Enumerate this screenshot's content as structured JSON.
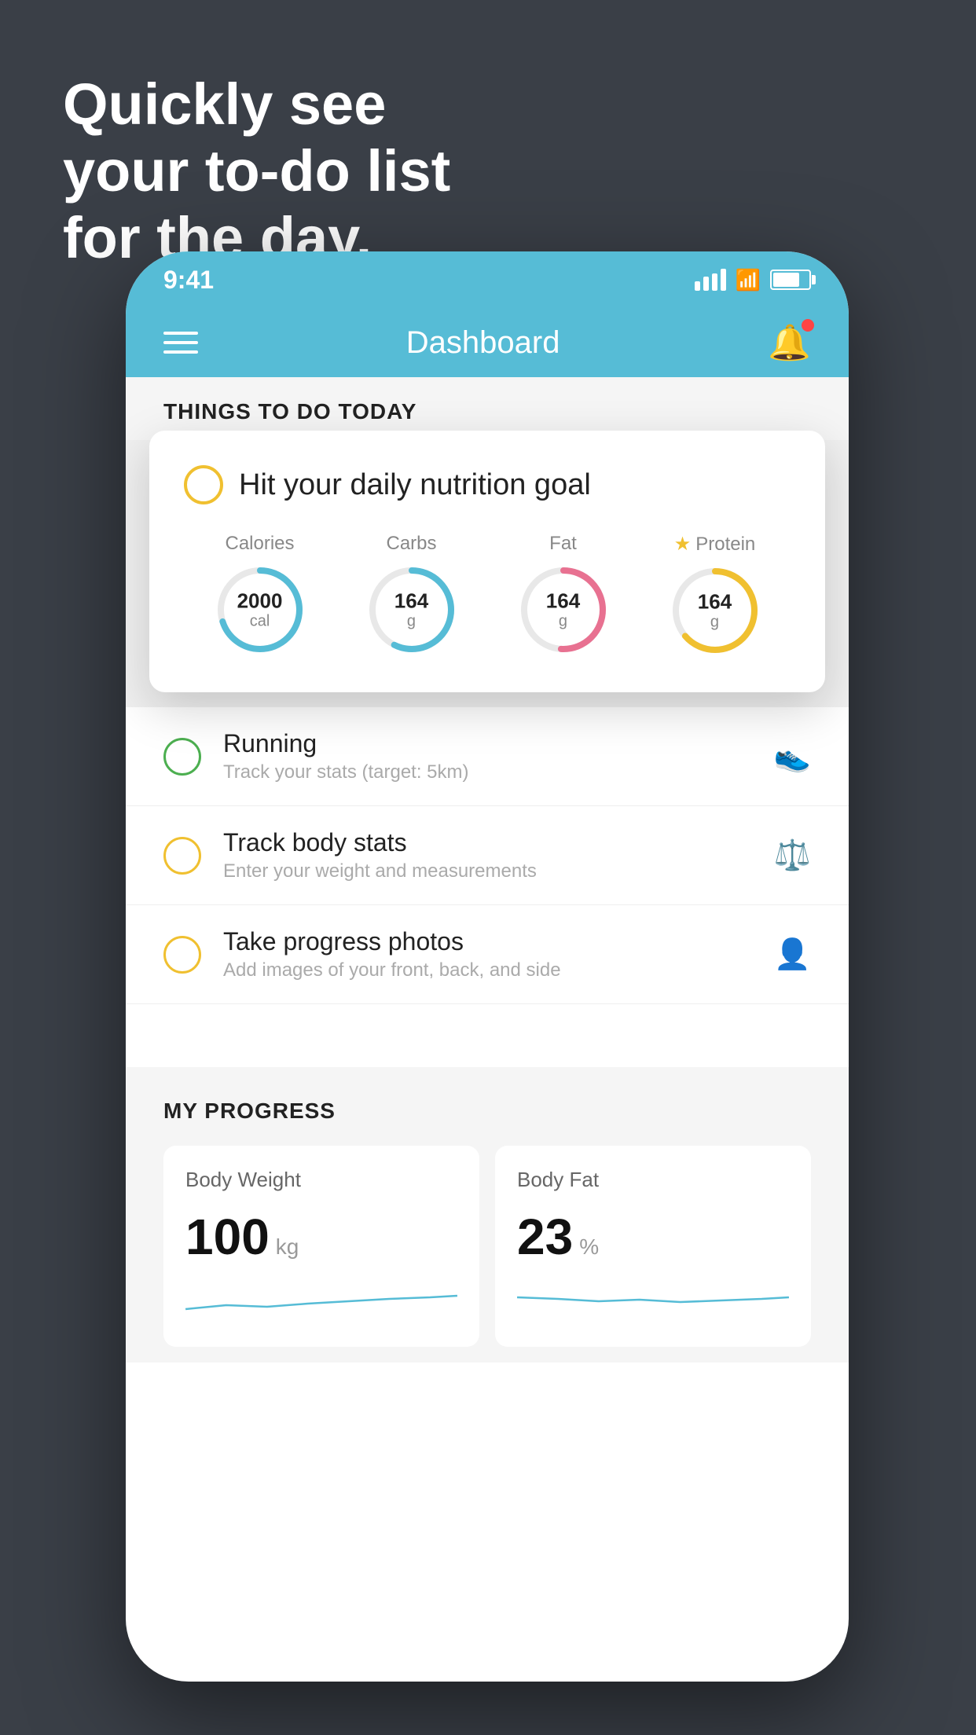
{
  "headline": {
    "line1": "Quickly see",
    "line2": "your to-do list",
    "line3": "for the day."
  },
  "status_bar": {
    "time": "9:41"
  },
  "nav": {
    "title": "Dashboard"
  },
  "things_section": {
    "title": "THINGS TO DO TODAY"
  },
  "nutrition_card": {
    "radio_color": "#f0c030",
    "title": "Hit your daily nutrition goal",
    "macros": [
      {
        "label": "Calories",
        "value": "2000",
        "unit": "cal",
        "color": "#56bcd6",
        "star": false
      },
      {
        "label": "Carbs",
        "value": "164",
        "unit": "g",
        "color": "#56bcd6",
        "star": false
      },
      {
        "label": "Fat",
        "value": "164",
        "unit": "g",
        "color": "#e87191",
        "star": false
      },
      {
        "label": "Protein",
        "value": "164",
        "unit": "g",
        "color": "#f0c030",
        "star": true
      }
    ]
  },
  "todo_items": [
    {
      "name": "Running",
      "desc": "Track your stats (target: 5km)",
      "circle_color": "green",
      "icon": "👟"
    },
    {
      "name": "Track body stats",
      "desc": "Enter your weight and measurements",
      "circle_color": "yellow",
      "icon": "⚖️"
    },
    {
      "name": "Take progress photos",
      "desc": "Add images of your front, back, and side",
      "circle_color": "yellow",
      "icon": "👤"
    }
  ],
  "progress_section": {
    "title": "MY PROGRESS",
    "cards": [
      {
        "title": "Body Weight",
        "value": "100",
        "unit": "kg"
      },
      {
        "title": "Body Fat",
        "value": "23",
        "unit": "%"
      }
    ]
  }
}
